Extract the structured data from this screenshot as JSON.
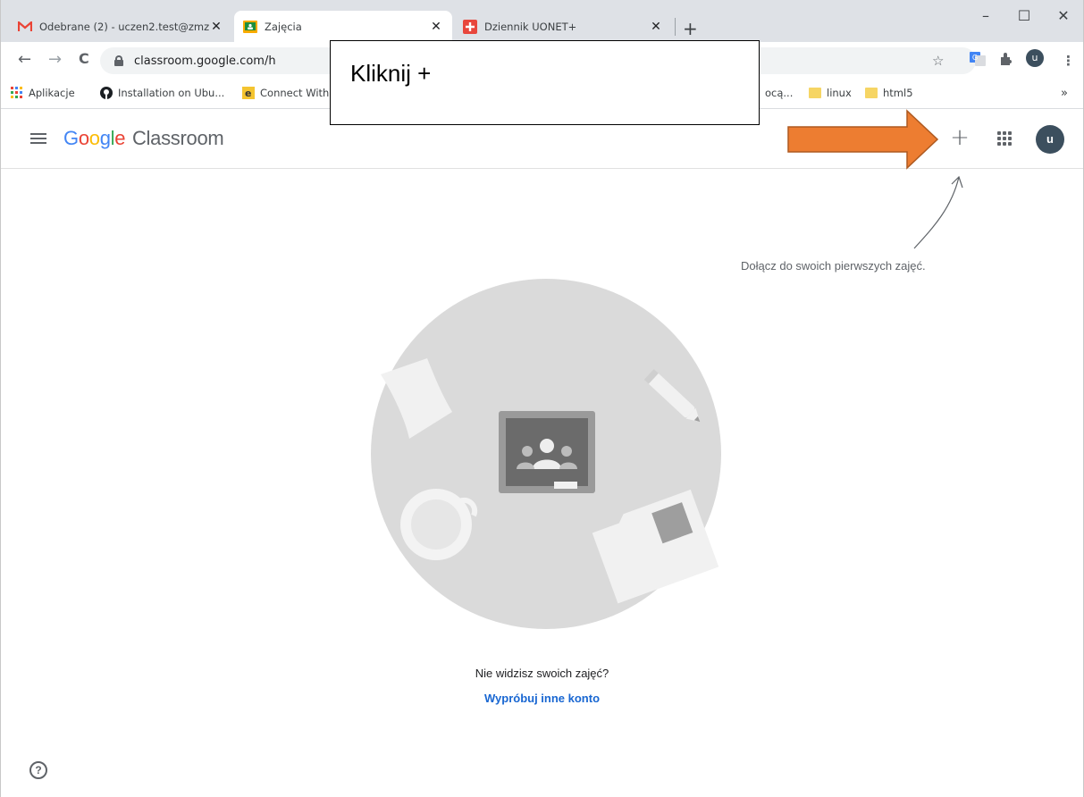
{
  "tabs": [
    {
      "title": "Odebrane (2) - uczen2.test@zmz",
      "close": "✕",
      "favicon": "gmail-icon",
      "active": false
    },
    {
      "title": "Zajęcia",
      "close": "✕",
      "favicon": "classroom-icon",
      "active": true
    },
    {
      "title": "Dziennik UONET+",
      "close": "✕",
      "favicon": "uonet-icon",
      "active": false
    }
  ],
  "newtab": "+",
  "window": {
    "minimize": "–",
    "maximize": "☐",
    "close": "✕"
  },
  "nav": {
    "back": "←",
    "forward": "→",
    "reload": "C"
  },
  "omnibox": {
    "url": "classroom.google.com/h"
  },
  "bookmarks": [
    {
      "label": "Aplikacje",
      "icon": "apps-grid-icon"
    },
    {
      "label": "Installation on Ubu...",
      "icon": "github-icon"
    },
    {
      "label": "Connect With",
      "icon": "e-icon"
    },
    {
      "label": "ocą...",
      "icon": "none"
    },
    {
      "label": "linux",
      "icon": "folder-icon"
    },
    {
      "label": "html5",
      "icon": "folder-icon"
    }
  ],
  "bookmarks_more": "»",
  "app": {
    "logo_google": "Google",
    "logo_classroom": "Classroom",
    "plus": "+",
    "avatar": "u",
    "hint": "Dołącz do swoich pierwszych zajęć.",
    "empty_question": "Nie widzisz swoich zajęć?",
    "try_other": "Wypróbuj inne konto",
    "help": "?"
  },
  "callout": {
    "text": "Kliknij +"
  },
  "colors": {
    "arrow": "#ed7d31",
    "arrow_border": "#ae5a21",
    "avatar": "#3c4f5e",
    "link": "#1967d2",
    "tabstrip": "#dee1e6"
  }
}
